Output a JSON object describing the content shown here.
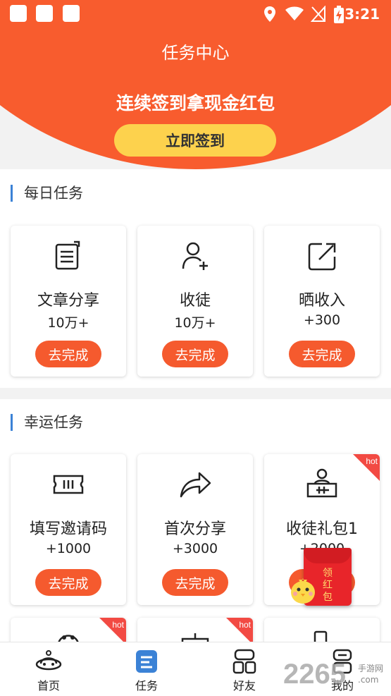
{
  "status_bar": {
    "time": "3:21"
  },
  "header": {
    "title": "任务中心",
    "subtitle": "连续签到拿现金红包",
    "sign_button": "立即签到"
  },
  "daily": {
    "title": "每日任务",
    "cards": [
      {
        "icon": "article-share-icon",
        "name": "文章分享",
        "value": "10万+",
        "button": "去完成"
      },
      {
        "icon": "add-user-icon",
        "name": "收徒",
        "value": "10万+",
        "button": "去完成"
      },
      {
        "icon": "share-out-icon",
        "name": "晒收入",
        "value": "+300",
        "button": "去完成"
      }
    ]
  },
  "lucky": {
    "title": "幸运任务",
    "cards": [
      {
        "icon": "ticket-icon",
        "name": "填写邀请码",
        "value": "+1000",
        "button": "去完成",
        "hot": ""
      },
      {
        "icon": "share-arrow-icon",
        "name": "首次分享",
        "value": "+3000",
        "button": "去完成",
        "hot": ""
      },
      {
        "icon": "gift-pack-icon",
        "name": "收徒礼包1",
        "value": "+2000",
        "button": "去完成",
        "hot": "hot"
      }
    ],
    "partial_row_hot": [
      "hot",
      "hot"
    ]
  },
  "red_packet": {
    "label": "领红包"
  },
  "tabs": [
    {
      "label": "首页",
      "icon": "planet-home-icon",
      "active": false
    },
    {
      "label": "任务",
      "icon": "task-list-icon",
      "active": true
    },
    {
      "label": "好友",
      "icon": "friends-icon",
      "active": false
    },
    {
      "label": "我的",
      "icon": "profile-icon",
      "active": false
    }
  ],
  "watermark": {
    "main": "2265",
    "side": "手游网 .com"
  },
  "colors": {
    "primary": "#f85c2e",
    "button": "#f55a2e",
    "sign": "#fdd24d",
    "accent_blue": "#3b82d6",
    "hot": "#f24a43"
  }
}
